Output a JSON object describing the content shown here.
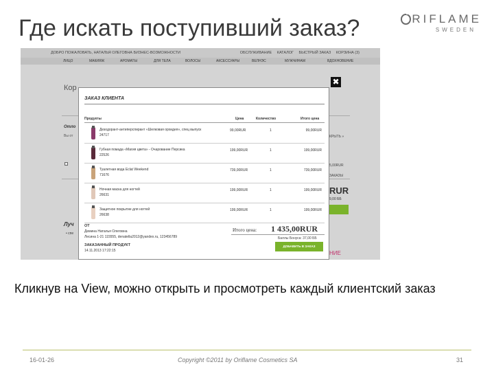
{
  "slide": {
    "title": "Где искать поступивший заказ?",
    "caption": "Кликнув на View, можно открыть и просмотреть каждый клиентский заказ"
  },
  "logo": {
    "brand": "RIFLAME",
    "sub": "SWEDEN"
  },
  "site": {
    "topbar_left": "ДОБРО ПОЖАЛОВАТЬ, НАТАЛЬЯ ОЛЕГОВНА   БИЗНЕС-ВОЗМОЖНОСТИ",
    "topbar_right": [
      "ОБСЛУЖИВАНИЕ",
      "КАТАЛОГ",
      "БЫСТРЫЙ ЗАКАЗ",
      "КОРЗИНА (3)"
    ],
    "nav": [
      "ЛИЦО",
      "МАКИЯЖ",
      "АРОМАТЫ",
      "ДЛЯ ТЕЛА",
      "ВОЛОСЫ",
      "АКСЕССУАРЫ",
      "ВЕЛНЭС",
      "МУЖЧИНАМ",
      "ВДОХНОВЕНИЕ"
    ],
    "bg_heading": "Кор",
    "bg_side1": "Отло",
    "bg_side2": "Вы от",
    "bg_side3": "Луч",
    "bg_side4": "• спе",
    "bg_right1": "КРЫТЬ »",
    "bg_right2": "5,00RUR",
    "bg_right3": "ЗАКАЗЫ",
    "bg_rur": "RUR",
    "bg_rur2": "9,00 ББ",
    "bg_pink": "НИЕ"
  },
  "modal": {
    "title": "ЗАКАЗ КЛИЕНТА",
    "close": "✖",
    "headers": {
      "product": "Продукты",
      "price": "Цена",
      "qty": "Количество",
      "total": "Итого цена"
    },
    "rows": [
      {
        "name": "Дезодорант-антиперспирант «Шелковая орхидея», спец выпуск",
        "code": "24717",
        "price": "99,00RUR",
        "qty": "1",
        "total": "99,00RUR",
        "thumb_color": "#8a3a6a"
      },
      {
        "name": "Губная помада «Магия цвета» - Очарование Персика",
        "code": "22526",
        "price": "199,00RUR",
        "qty": "1",
        "total": "199,00RUR",
        "thumb_color": "#5a2a3a"
      },
      {
        "name": "Туалетная вода Eclat Weekend",
        "code": "71676",
        "price": "739,00RUR",
        "qty": "1",
        "total": "739,00RUR",
        "thumb_color": "#c9a37a"
      },
      {
        "name": "Ночная маска для ногтей",
        "code": "26631",
        "price": "199,00RUR",
        "qty": "1",
        "total": "199,00RUR",
        "thumb_color": "#e0c8b8"
      },
      {
        "name": "Защитное покрытие для ногтей",
        "code": "26638",
        "price": "199,00RUR",
        "qty": "1",
        "total": "199,00RUR",
        "thumb_color": "#e8d0c0"
      }
    ],
    "from_label": "ОТ",
    "from_name": "Демина Наталья Олеговна",
    "from_contact": "Лесина 1-21 115555, denatella2012@yandex.ru, 123456789",
    "ordered_label": "ЗАКАЗАННЫЙ ПРОДУКТ",
    "ordered_date": "14.11.2013 17:22:15",
    "sum_label": "Итого цена:",
    "sum_value": "1 435,00RUR",
    "bonus": "Баллы Бонуса: 37,00 ББ",
    "add_button": "ДОБАВИТЬ В ЗАКАЗ"
  },
  "footer": {
    "date": "16-01-26",
    "copyright": "Copyright ©2011 by Oriflame Cosmetics SA",
    "page": "31"
  },
  "colors": {
    "accent_green": "#7ab32b",
    "footer_line": "#b9c06a"
  }
}
